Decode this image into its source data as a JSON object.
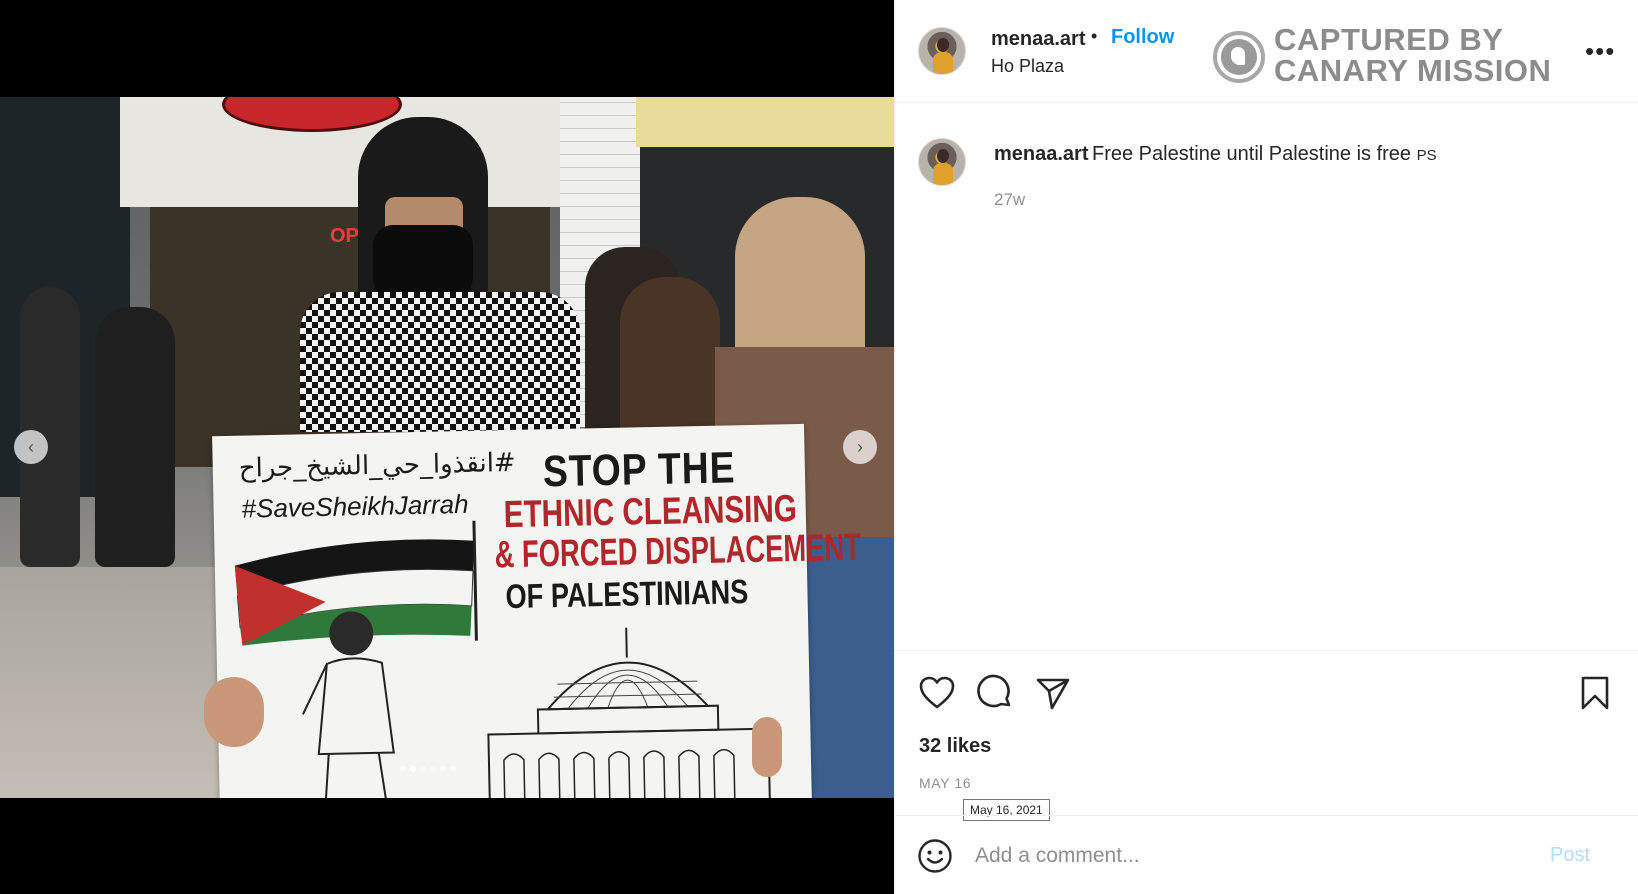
{
  "post": {
    "username": "menaa.art",
    "follow_label": "Follow",
    "separator": "•",
    "location": "Ho Plaza",
    "more_icon_label": "•••"
  },
  "watermark": {
    "line1": "CAPTURED BY",
    "line2": "CANARY MISSION"
  },
  "caption": {
    "username": "menaa.art",
    "text": "Free Palestine until Palestine is free",
    "suffix": "PS",
    "time": "27w"
  },
  "engagement": {
    "likes": "32 likes",
    "date": "MAY 16",
    "date_tooltip": "May 16, 2021"
  },
  "comment": {
    "placeholder": "Add a comment...",
    "post_label": "Post"
  },
  "media": {
    "placard_hashtag_ar": "#انقذوا_حي_الشيخ_جراح",
    "placard_hashtag_en": "#SaveSheikhJarrah",
    "placard_line1": "STOP THE",
    "placard_line2": "ETHNIC CLEANSING",
    "placard_line3": "& FORCED DISPLACEMENT",
    "placard_line4": "OF PALESTINIANS",
    "storefront_neon": "OPE",
    "carousel_count": 6,
    "carousel_active": 2
  },
  "icons": {
    "like": "heart-icon",
    "comment": "comment-icon",
    "share": "paper-plane-icon",
    "save": "bookmark-icon",
    "emoji": "smiley-icon",
    "prev": "chevron-left-icon",
    "next": "chevron-right-icon",
    "more": "ellipsis-icon"
  },
  "colors": {
    "follow": "#0095f6",
    "post_disabled": "#b3dbff",
    "muted": "#8e8e8e",
    "watermark": "#8c8c8c",
    "placard_red": "#b0262b"
  }
}
